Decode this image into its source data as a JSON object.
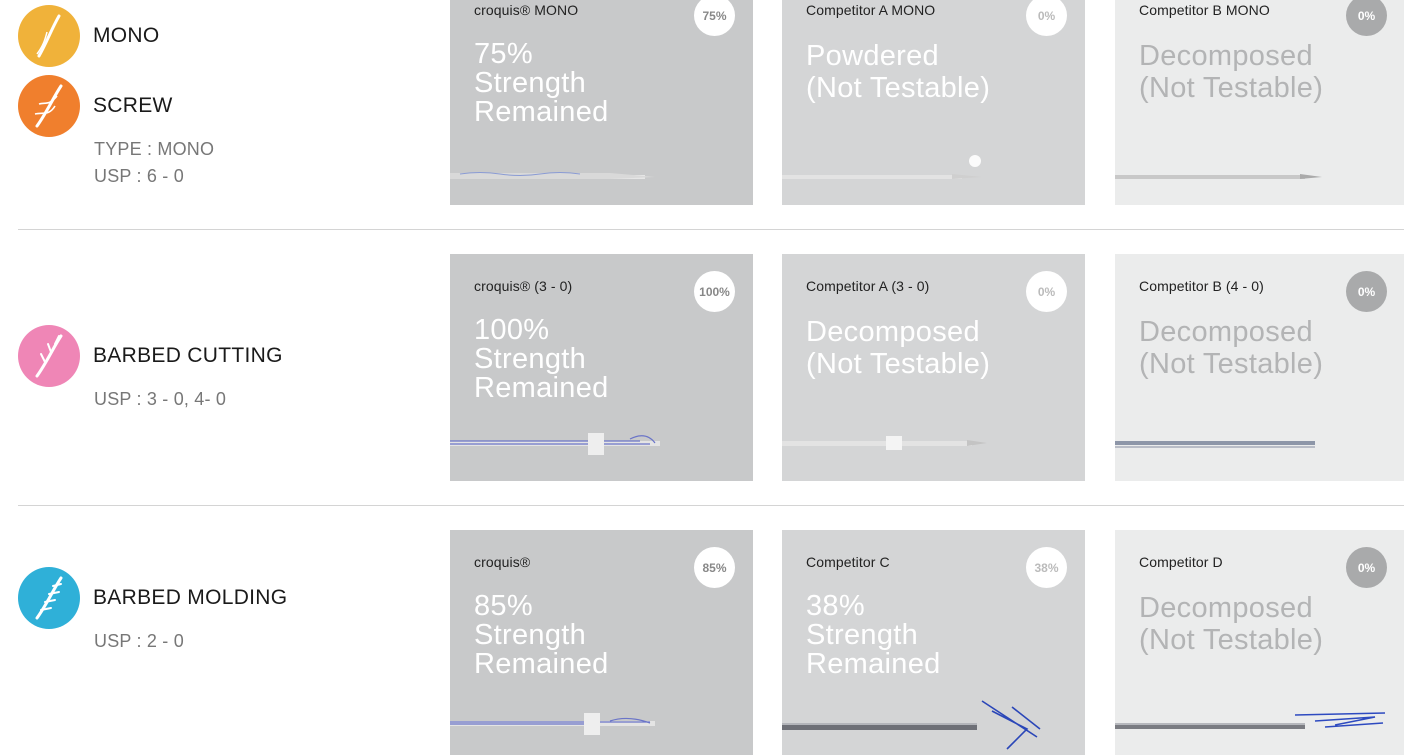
{
  "colors": {
    "mono": "#f0b23a",
    "screw": "#f07f2d",
    "barbed_cutting": "#ef86b6",
    "barbed_molding": "#2fb0d8",
    "card_dark": "#c8c9ca",
    "card_mid": "#d4d5d6",
    "card_light": "#ebecec"
  },
  "sections": [
    {
      "categories": [
        {
          "name": "MONO",
          "icon": "mono-thread-icon"
        },
        {
          "name": "SCREW",
          "icon": "screw-thread-icon"
        }
      ],
      "meta": [
        "TYPE : MONO",
        "USP : 6 - 0"
      ],
      "cards": [
        {
          "label": "croquis® MONO",
          "badge": "75%",
          "headline": [
            "75%",
            "Strength",
            "Remained"
          ]
        },
        {
          "label": "Competitor A MONO",
          "badge": "0%",
          "headline": [
            "Powdered",
            "(Not Testable)"
          ]
        },
        {
          "label": "Competitor B MONO",
          "badge": "0%",
          "headline": [
            "Decomposed",
            "(Not Testable)"
          ]
        }
      ]
    },
    {
      "categories": [
        {
          "name": "BARBED CUTTING",
          "icon": "barbed-cutting-icon"
        }
      ],
      "meta": [
        "USP : 3 - 0, 4- 0"
      ],
      "cards": [
        {
          "label": "croquis® (3 - 0)",
          "badge": "100%",
          "headline": [
            "100%",
            "Strength",
            "Remained"
          ]
        },
        {
          "label": "Competitor A (3 - 0)",
          "badge": "0%",
          "headline": [
            "Decomposed",
            "(Not Testable)"
          ]
        },
        {
          "label": "Competitor B (4 - 0)",
          "badge": "0%",
          "headline": [
            "Decomposed",
            "(Not Testable)"
          ]
        }
      ]
    },
    {
      "categories": [
        {
          "name": "BARBED MOLDING",
          "icon": "barbed-molding-icon"
        }
      ],
      "meta": [
        "USP : 2 - 0"
      ],
      "cards": [
        {
          "label": "croquis®",
          "badge": "85%",
          "headline": [
            "85%",
            "Strength",
            "Remained"
          ]
        },
        {
          "label": "Competitor C",
          "badge": "38%",
          "headline": [
            "38%",
            "Strength",
            "Remained"
          ]
        },
        {
          "label": "Competitor D",
          "badge": "0%",
          "headline": [
            "Decomposed",
            "(Not Testable)"
          ]
        }
      ]
    }
  ]
}
